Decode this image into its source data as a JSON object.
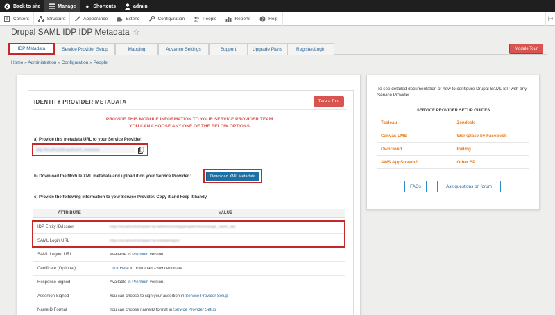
{
  "toolbar": {
    "back_to_site": "Back to site",
    "manage": "Manage",
    "shortcuts": "Shortcuts",
    "user": "admin"
  },
  "tray": {
    "content": "Content",
    "structure": "Structure",
    "appearance": "Appearance",
    "extend": "Extend",
    "configuration": "Configuration",
    "people": "People",
    "reports": "Reports",
    "help": "Help"
  },
  "page": {
    "title": "Drupal SAML IDP IDP Metadata",
    "module_tour": "Module Tour"
  },
  "tabs": [
    {
      "label": "IDP Metadata"
    },
    {
      "label": "Service Provider Setup"
    },
    {
      "label": "Mapping"
    },
    {
      "label": "Advance Settings"
    },
    {
      "label": "Support"
    },
    {
      "label": "Upgrade Plans"
    },
    {
      "label": "Register/Login"
    }
  ],
  "breadcrumb": {
    "home": "Home",
    "administration": "Administration",
    "configuration": "Configuration",
    "people": "People",
    "sep": "»"
  },
  "idp": {
    "title": "IDENTITY PROVIDER METADATA",
    "take_tour": "Take a Tour",
    "notice_line1": "PROVIDE THIS MODULE INFORMATION TO YOUR SERVICE PROVIDER TEAM.",
    "notice_line2": "YOU CAN CHOOSE ANY ONE OF THE BELOW OPTIONS.",
    "step_a": "a) Provide this metadata URL to your Service Provider:",
    "metadata_url": "http://localhost/drupal/saml_metadata",
    "step_b": "b) Download the Module XML metadata and upload it on your Service Provider :",
    "download_button": "Download XML Metadata",
    "step_c": "c) Provide the following information to your Service Provider. Copy it and keep it handy."
  },
  "table": {
    "headers": [
      "ATTRIBUTE",
      "VALUE"
    ],
    "rows": [
      {
        "attr": "IDP Entity ID/Issuer",
        "value": "http://localhost/drupal/?q=admin/config/people/miniorange_saml_idp"
      },
      {
        "attr": "SAML Login URL",
        "value": "http://localhost/drupal/?q=initiatelogon"
      },
      {
        "attr": "SAML Logout URL",
        "prefix": "Available in ",
        "link": "Premium",
        "suffix": " version."
      },
      {
        "attr": "Certificate (Optional)",
        "prefix": "",
        "link": "Click Here",
        "suffix": " to download X509 certificate."
      },
      {
        "attr": "Response Signed",
        "prefix": "Available in ",
        "link": "Premium",
        "suffix": " version."
      },
      {
        "attr": "Assertion Signed",
        "prefix": "You can choose to sign your assertion in ",
        "link": "Service Provider Setup",
        "suffix": ""
      },
      {
        "attr": "NameID Format",
        "prefix": "You can choose nameID format in ",
        "link": "Service Provider Setup",
        "suffix": ""
      }
    ]
  },
  "side": {
    "intro": "To see detailed documentation of how to configure Drupal SAML IdP with any Service Provider",
    "guides_title": "SERVICE PROVIDER SETUP GUIDES",
    "guides": [
      [
        "Tableau",
        "Zendesk"
      ],
      [
        "Canvas LMS",
        "Workplace by Facebook"
      ],
      [
        "Owncloud",
        "Inkling"
      ],
      [
        "AWS AppStream2",
        "Other SP"
      ]
    ],
    "faqs": "FAQs",
    "ask": "Ask questions on forum"
  },
  "colors": {
    "accent_red": "#d9534f",
    "highlight_red": "#c62828",
    "link_blue": "#2a6496",
    "guide_orange": "#e67e22",
    "button_blue": "#1d6fa5"
  }
}
